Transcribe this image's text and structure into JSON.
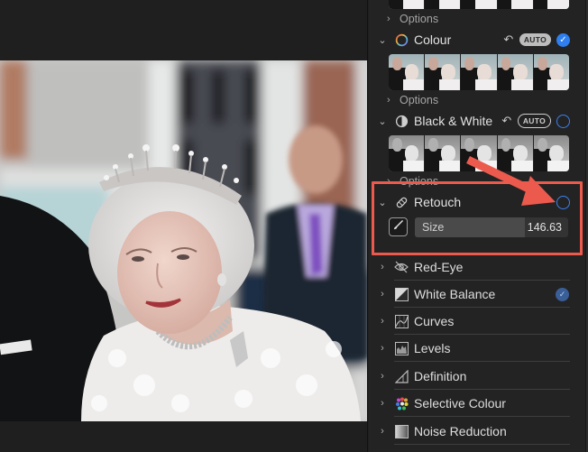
{
  "canvas": {
    "photo_description": "Elderly woman wearing a diamond tiara, necklace and white feathered dress, with blurred people in the background"
  },
  "panel": {
    "top_options_label": "Options",
    "sections": [
      {
        "title": "Colour",
        "icon": "colour-wheel-icon",
        "expanded": true,
        "undo_icon": "revert-icon",
        "auto_label": "AUTO",
        "enabled": true,
        "options_label": "Options"
      },
      {
        "title": "Black & White",
        "icon": "half-circle-icon",
        "expanded": true,
        "undo_icon": "revert-icon",
        "auto_label": "AUTO",
        "enabled": false,
        "options_label": "Options"
      },
      {
        "title": "Retouch",
        "icon": "bandage-icon",
        "expanded": true,
        "undo_icon": "revert-icon",
        "enabled": false,
        "size_label": "Size",
        "size_value": "146.63",
        "size_fill_fraction": 0.72
      }
    ],
    "tools": [
      {
        "label": "Red-Eye",
        "icon": "red-eye-icon",
        "enabled": false
      },
      {
        "label": "White Balance",
        "icon": "white-balance-icon",
        "enabled": true
      },
      {
        "label": "Curves",
        "icon": "curves-icon",
        "enabled": false
      },
      {
        "label": "Levels",
        "icon": "levels-icon",
        "enabled": false
      },
      {
        "label": "Definition",
        "icon": "definition-icon",
        "enabled": false
      },
      {
        "label": "Selective Colour",
        "icon": "selective-colour-icon",
        "enabled": false
      },
      {
        "label": "Noise Reduction",
        "icon": "noise-reduction-icon",
        "enabled": false
      }
    ]
  },
  "annotation": {
    "highlight_color": "#ec5a4e",
    "arrow_color": "#ec5a4e"
  },
  "colors": {
    "accent_blue": "#2f7ff0",
    "panel_bg": "#232323"
  }
}
